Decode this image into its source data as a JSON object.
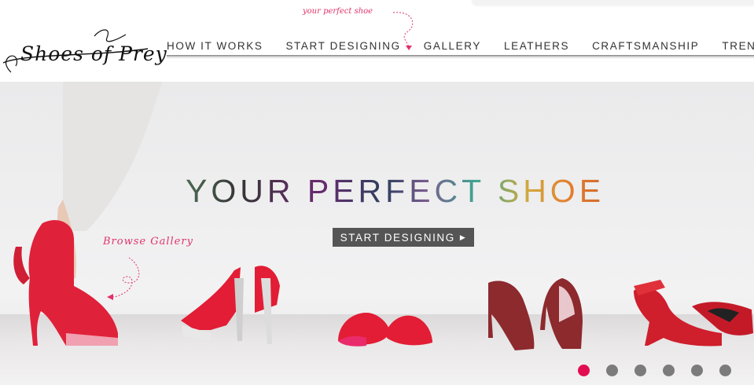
{
  "logo": {
    "text": "Shoes of Prey"
  },
  "tagline": "your perfect shoe",
  "nav": {
    "items": [
      {
        "label": "HOW IT WORKS"
      },
      {
        "label": "START DESIGNING"
      },
      {
        "label": "GALLERY"
      },
      {
        "label": "LEATHERS"
      },
      {
        "label": "CRAFTSMANSHIP"
      },
      {
        "label": "TRENDS"
      }
    ]
  },
  "hero": {
    "title": "YOUR PERFECT SHOE",
    "cta_label": "START DESIGNING",
    "browse_label": "Browse Gallery"
  },
  "carousel": {
    "slide_count": 6,
    "active_index": 0
  },
  "colors": {
    "accent": "#e30d52",
    "cta_bg": "#555555",
    "dot": "#7b7b7b",
    "tagline": "#e0336a"
  }
}
